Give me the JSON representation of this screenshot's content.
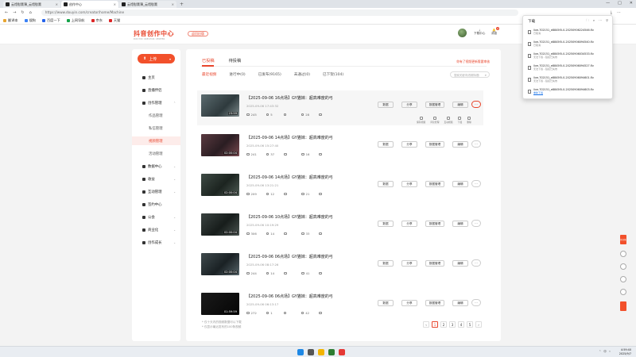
{
  "browser": {
    "tabs": [
      {
        "label": "云馆慰薰薄_云馆慰薰"
      },
      {
        "label": "创作中心"
      },
      {
        "label": "云馆慰薰薄_云馆慰薰"
      }
    ],
    "url": "https://www.douyin.com/creator/home/Machine",
    "bookmarks": [
      "翻译本",
      "搜狗",
      "百度一下",
      "上网导航",
      "京东",
      "天猫"
    ],
    "window_controls": [
      "—",
      "□",
      "✕"
    ]
  },
  "header": {
    "logo_title": "抖音创作中心",
    "logo_subtitle": "DOUYIN CREATOR CENTER",
    "back_old": "返回旧版",
    "download_center": "下载中心",
    "messages": "消息",
    "msg_badge": "2"
  },
  "sidebar": {
    "upload": "上传",
    "items": [
      {
        "label": "主页",
        "type": "top"
      },
      {
        "label": "直播伴侣",
        "type": "top"
      },
      {
        "label": "创作管理",
        "type": "top",
        "chev": "⌃"
      },
      {
        "label": "作品管理",
        "type": "sub"
      },
      {
        "label": "私信管理",
        "type": "sub"
      },
      {
        "label": "视频管理",
        "type": "sub",
        "active": true
      },
      {
        "label": "活动管理",
        "type": "sub"
      },
      {
        "label": "数据中心",
        "type": "top",
        "chev": "⌄"
      },
      {
        "label": "收益",
        "type": "top",
        "chev": "⌄"
      },
      {
        "label": "互动管理",
        "type": "top",
        "chev": "⌄"
      },
      {
        "label": "签约中心",
        "type": "top"
      },
      {
        "label": "公会",
        "type": "top",
        "chev": "⌄"
      },
      {
        "label": "商业化",
        "type": "top",
        "chev": "⌄"
      },
      {
        "label": "创作成长",
        "type": "top",
        "chev": "⌄"
      }
    ]
  },
  "main": {
    "tabs": [
      "已投稿",
      "待投稿"
    ],
    "top_right_link": "你有了视频更新需要审核",
    "filters": [
      "最近视频",
      "进行中(0)",
      "已发布(9165)",
      "未通过(0)",
      "已下架(104)"
    ],
    "search_placeholder": "搜索关键词/视频标题",
    "row_buttons": [
      "数据",
      "分享",
      "数据管理",
      "编辑"
    ],
    "more": "···",
    "sub_actions": [
      "保存视频",
      "评论管理",
      "互动视频",
      "下载",
      "删除"
    ],
    "rows": [
      {
        "title": "【2025-09-06 16点场】GY猫妹：超高难度的弓",
        "time": "2025-09-06 17:43:32",
        "duration": "23:59",
        "stats": [
          "245",
          "5",
          "",
          "28",
          ""
        ]
      },
      {
        "title": "【2025-09-06 14点场】GY猫妹：超高难度的弓",
        "time": "2025-09-06 15:27:40",
        "duration": "02:00:04",
        "stats": [
          "241",
          "37",
          "",
          "16",
          ""
        ]
      },
      {
        "title": "【2025-09-06 14点场】GY猫妹：超高难度的弓",
        "time": "2025-09-06 13:21:21",
        "duration": "02:00:04",
        "stats": [
          "209",
          "12",
          "",
          "21",
          ""
        ]
      },
      {
        "title": "【2025-09-06 10点场】GY猫妹：超高难度的弓",
        "time": "2025-09-06 10:19:29",
        "duration": "02:00:04",
        "stats": [
          "306",
          "14",
          "",
          "33",
          ""
        ]
      },
      {
        "title": "【2025-09-06 06点场】GY猫妹：超高难度的弓",
        "time": "2025-09-06 08:17:26",
        "duration": "02:00:04",
        "stats": [
          "244",
          "14",
          "",
          "41",
          ""
        ]
      },
      {
        "title": "【2025-09-06 06点场】GY猫妹：超高难度的弓",
        "time": "2025-09-06 06:13:17",
        "duration": "01:59:59",
        "stats": [
          "272",
          "1",
          "",
          "42",
          ""
        ]
      }
    ],
    "footer": [
      "* 仅十天内的视频数据可以下载",
      "* 仅显示最近发布的100条视频"
    ],
    "pager": [
      "‹",
      "1",
      "2",
      "3",
      "4",
      "5",
      "›"
    ]
  },
  "downloads": {
    "title": "下载",
    "items": [
      {
        "name": "live-702151_e8845f0-0-20250906224546.flv",
        "status": "已取消"
      },
      {
        "name": "live-702151_e8845f0-0-20250906094540.flv",
        "status": "已取消"
      },
      {
        "name": "live-702151_e8845f0-0-20250906034533.flv",
        "status": "无法下载 - 链接已失效"
      },
      {
        "name": "live-702151_e8845f0-0-20250906094527.flv",
        "status": "无法下载 - 链接已失效"
      },
      {
        "name": "live-702151_e8845f0-0-20250906094601.flv",
        "status": "无法下载 - 链接已失效"
      },
      {
        "name": "live-702151_e8845f0-0-20250906094603.flv",
        "status": "重新下载"
      }
    ]
  },
  "rightbar": {
    "red_label": "新功能"
  },
  "taskbar": {
    "time": "4:59:40",
    "date": "2025/9/7",
    "lang": "中"
  }
}
